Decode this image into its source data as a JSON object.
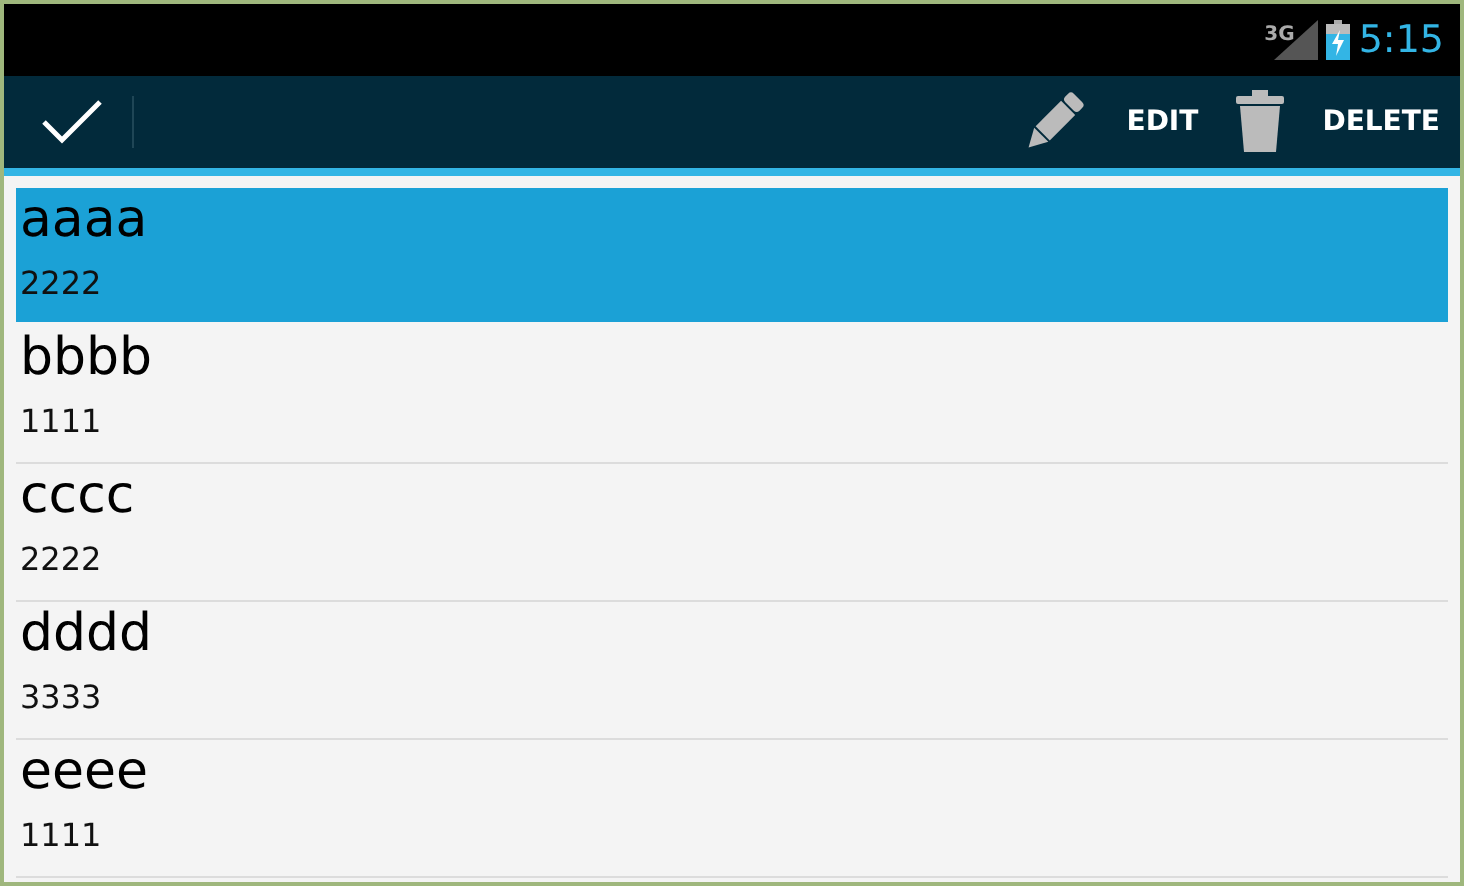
{
  "status_bar": {
    "network": "3G",
    "time": "5:15"
  },
  "action_bar": {
    "actions": [
      {
        "kind": "edit",
        "label": "EDIT"
      },
      {
        "kind": "delete",
        "label": "DELETE"
      }
    ]
  },
  "list": [
    {
      "title": "aaaa",
      "subtitle": "2222",
      "selected": true
    },
    {
      "title": "bbbb",
      "subtitle": "1111",
      "selected": false
    },
    {
      "title": "cccc",
      "subtitle": "2222",
      "selected": false
    },
    {
      "title": "dddd",
      "subtitle": "3333",
      "selected": false
    },
    {
      "title": "eeee",
      "subtitle": "1111",
      "selected": false
    }
  ]
}
